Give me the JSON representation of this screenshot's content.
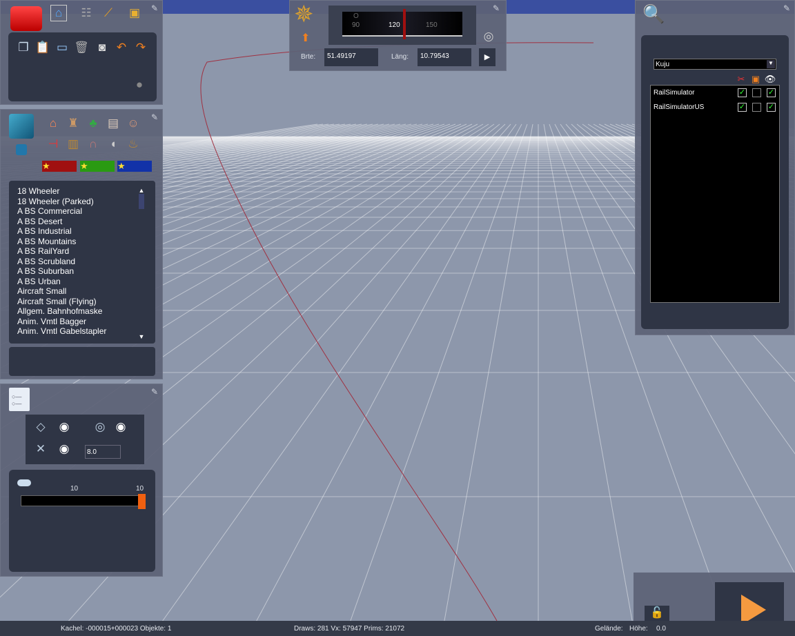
{
  "toolbox": {
    "tabs": [
      "home-icon",
      "track-icon",
      "brush-icon",
      "train-icon"
    ],
    "tools": [
      "copy-icon",
      "paste-icon",
      "monitor-icon",
      "trash-icon",
      "measure-icon",
      "undo-icon",
      "redo-icon"
    ]
  },
  "objects": {
    "categories": [
      "house-icon",
      "factory-icon",
      "tree-icon",
      "bridge-icon",
      "person-icon",
      "signal-icon",
      "bench-icon",
      "arch-icon",
      "speaker-icon",
      "sack-icon"
    ],
    "favorites": [
      "#b01010",
      "#22a010",
      "#1030b0"
    ],
    "list": [
      "18 Wheeler",
      "18 Wheeler (Parked)",
      "A BS Commercial",
      "A BS Desert",
      "A BS Industrial",
      "A BS Mountains",
      "A BS RailYard",
      "A BS Scrubland",
      "A BS Suburban",
      "A BS Urban",
      "Aircraft Small",
      "Aircraft Small (Flying)",
      "Allgem. Bahnhofmaske",
      "Anim. Vmtl Bagger",
      "Anim. Vmtl Gabelstapler"
    ]
  },
  "properties": {
    "value_field": "8.0",
    "slider_min_label": "10",
    "slider_max_label": "10",
    "slider_fraction": 1.0
  },
  "compass": {
    "ticks": [
      "90",
      "120",
      "150"
    ],
    "heading_letter": "O",
    "brte_label": "Brte:",
    "brte_value": "51.49197",
    "laeng_label": "Läng:",
    "laeng_value": "10.79543"
  },
  "layers": {
    "provider": "Kuju",
    "rows": [
      {
        "name": "RailSimulator",
        "checks": [
          true,
          false,
          true
        ]
      },
      {
        "name": "RailSimulatorUS",
        "checks": [
          true,
          false,
          true
        ]
      }
    ]
  },
  "status": {
    "kachel": "Kachel: -000015+000023  Objekte: 1",
    "draws": "Draws: 281 Vx: 57947 Prims: 21072",
    "gelaende": "Gelände:",
    "hoehe_label": "Höhe:",
    "hoehe_value": "0.0"
  },
  "colors": {
    "accent": "#f07a1a",
    "sky": "#3a4fa0",
    "ground": "#8d97ab"
  }
}
